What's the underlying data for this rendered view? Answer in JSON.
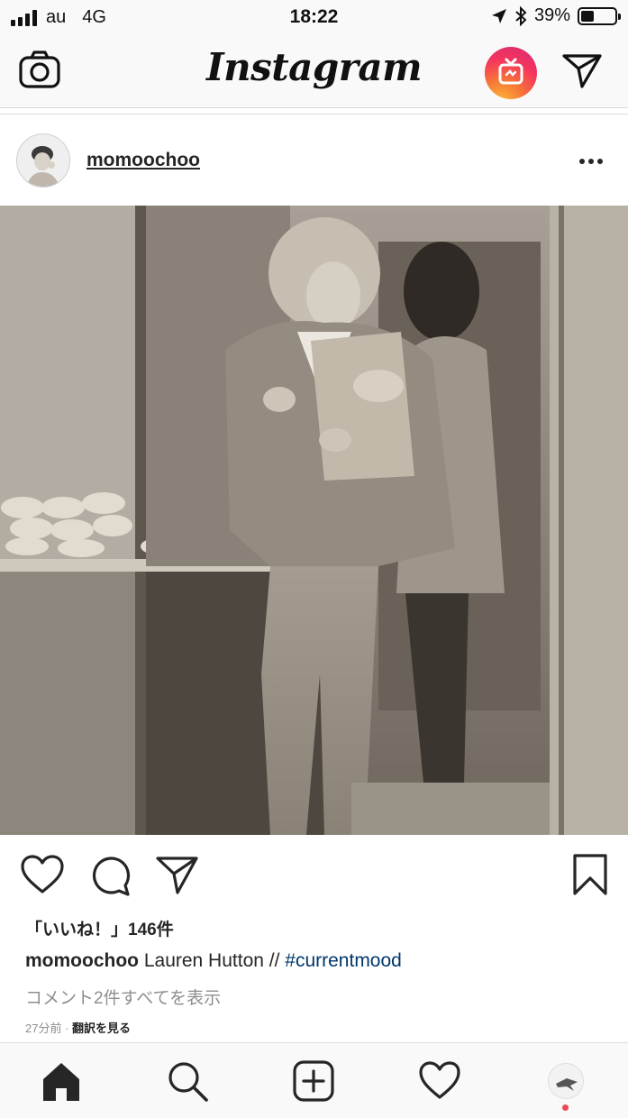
{
  "status_bar": {
    "carrier": "au",
    "network": "4G",
    "time": "18:22",
    "battery_percent": "39%",
    "battery_level": 0.39,
    "icons": [
      "signal-icon",
      "location-arrow-icon",
      "bluetooth-icon",
      "battery-icon"
    ]
  },
  "header": {
    "logo": "Instagram",
    "icons": [
      "camera-icon",
      "igtv-icon",
      "direct-send-icon"
    ],
    "igtv_gradient": [
      "#fdc033",
      "#f77737",
      "#f5365c",
      "#d62976"
    ]
  },
  "post": {
    "username": "momoochoo",
    "photo_alt_icon": "photo",
    "likes_text": "「いいね！」146件",
    "caption": {
      "username": "momoochoo",
      "text": " Lauren Hutton // ",
      "hashtag": "#currentmood"
    },
    "comments_link": "コメント2件すべてを表示",
    "timestamp": "27分前",
    "separator": " · ",
    "translate_link": "翻訳を見る"
  },
  "bottom_nav": {
    "items": [
      "home-icon",
      "search-icon",
      "new-post-icon",
      "activity-heart-icon",
      "profile-avatar"
    ],
    "notification_color": "#ed4956"
  },
  "colors": {
    "text": "#262626",
    "muted": "#8e8e8e",
    "link": "#00376b",
    "bar_bg": "#f9f9f9",
    "border": "#dbdbdb"
  }
}
